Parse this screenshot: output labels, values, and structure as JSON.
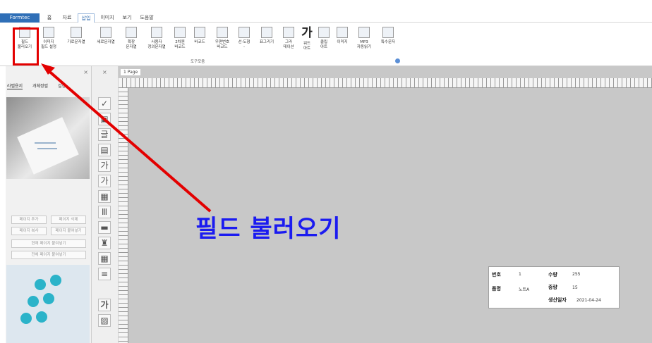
{
  "menubar": {
    "brand": "Formtec",
    "tabs": [
      "홈",
      "자료",
      "삽입",
      "이미지",
      "보기",
      "도움말"
    ],
    "active_tab": "삽입"
  },
  "ribbon": {
    "buttons": [
      {
        "label": "필드\n불러오기",
        "icon": "field-load-icon"
      },
      {
        "label": "이미지\n필드 설정",
        "icon": "image-field-icon"
      },
      {
        "label": "가로문자열",
        "icon": "horizontal-text-icon"
      },
      {
        "label": "세로문자열",
        "icon": "vertical-text-icon"
      },
      {
        "label": "확장\n문자열",
        "icon": "extended-text-icon"
      },
      {
        "label": "사용자\n정의문자열",
        "icon": "custom-text-icon"
      },
      {
        "label": "2차원\n바코드",
        "icon": "qr-code-icon"
      },
      {
        "label": "바코드",
        "icon": "barcode-icon"
      },
      {
        "label": "우편번호\n바코드",
        "icon": "postal-barcode-icon"
      },
      {
        "label": "선·도형\n-",
        "icon": "shape-icon"
      },
      {
        "label": "표그리기",
        "icon": "table-icon"
      },
      {
        "label": "그라\n데이션",
        "icon": "gradient-icon"
      },
      {
        "label": "워드\n아트",
        "icon": "word-art-icon",
        "glyph": "가"
      },
      {
        "label": "클립\n아트",
        "icon": "clip-art-icon"
      },
      {
        "label": "이미지",
        "icon": "image-icon"
      },
      {
        "label": "MP3\n자동읽기",
        "icon": "mp3-icon"
      },
      {
        "label": "특수문자",
        "icon": "special-char-icon"
      }
    ],
    "group_label": "도구모음"
  },
  "left_panel": {
    "tabs": [
      "라벨용지",
      "개체정렬",
      "설정"
    ],
    "buttons": [
      "페이지 추가",
      "페이지 삭제",
      "페이지 복사",
      "페이지 붙여넣기",
      "현재 페이지 붙여넣기",
      "전체 페이지 붙여넣기"
    ],
    "close": "×"
  },
  "second_panel": {
    "close": "×",
    "tools": [
      "✓",
      "▣",
      "글",
      "▤",
      "가",
      "가",
      "▦",
      "Ⅲ",
      "▬",
      "♜",
      "▦",
      "≡",
      "가",
      "▨"
    ]
  },
  "canvas": {
    "page_tab": "1 Page",
    "label": {
      "k_number": "번호",
      "v_number": "1",
      "k_item": "품명",
      "v_item": "노트A",
      "k_qty": "수량",
      "v_qty": "255",
      "k_weight": "중량",
      "v_weight": "15",
      "k_date": "생산일자",
      "v_date": "2021-04-24"
    }
  },
  "annotation": {
    "text": "필드 불러오기",
    "color": "#e30000",
    "text_color": "#1b1bf0"
  }
}
